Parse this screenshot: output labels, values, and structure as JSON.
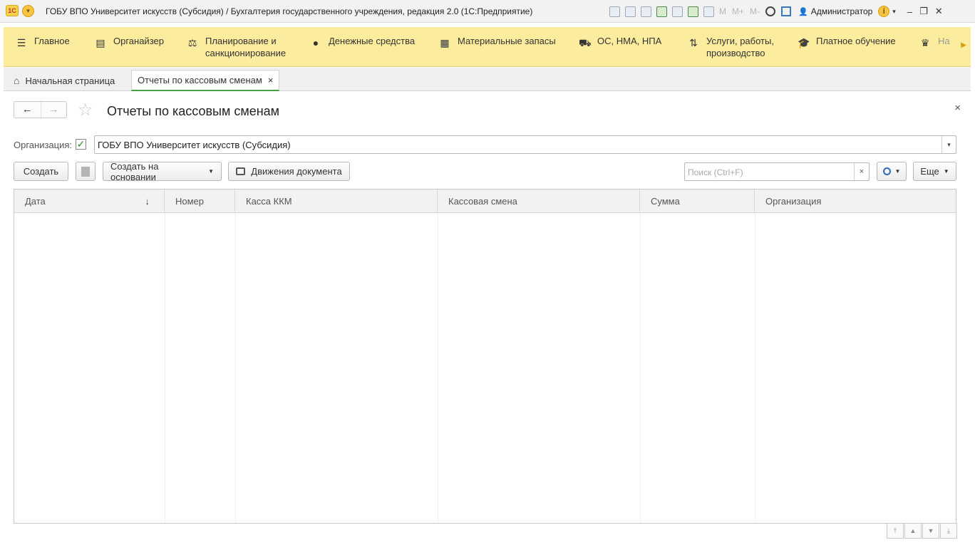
{
  "window": {
    "logo": "1C",
    "title": "ГОБУ ВПО Университет искусств (Субсидия) / Бухгалтерия государственного учреждения, редакция 2.0  (1С:Предприятие)",
    "memory_labels": [
      "M",
      "M+",
      "M-"
    ],
    "user": "Администратор",
    "info_glyph": "i"
  },
  "sections": [
    {
      "icon": "hamburger-icon",
      "label": "Главное"
    },
    {
      "icon": "organizer-icon",
      "label": "Органайзер"
    },
    {
      "icon": "planning-icon",
      "label": "Планирование и санкционирование"
    },
    {
      "icon": "ruble-coin-icon",
      "label": "Денежные средства"
    },
    {
      "icon": "warehouse-icon",
      "label": "Материальные запасы"
    },
    {
      "icon": "truck-icon",
      "label": "ОС, НМА, НПА"
    },
    {
      "icon": "tools-icon",
      "label": "Услуги, работы, производство"
    },
    {
      "icon": "graduation-cap-icon",
      "label": "Платное обучение"
    },
    {
      "icon": "emblem-icon",
      "label": "На"
    }
  ],
  "tabs": {
    "home": "Начальная страница",
    "active": "Отчеты по кассовым сменам",
    "close_glyph": "×"
  },
  "form": {
    "title": "Отчеты по кассовым сменам",
    "organization_label": "Организация:",
    "organization_checked": true,
    "organization_value": "ГОБУ ВПО Университет искусств (Субсидия)",
    "buttons": {
      "create": "Создать",
      "create_based_on": "Создать на основании",
      "document_movements": "Движения документа",
      "more": "Еще"
    },
    "search": {
      "placeholder": "Поиск (Ctrl+F)",
      "value": ""
    }
  },
  "table": {
    "columns": [
      "Дата",
      "Номер",
      "Касса ККМ",
      "Кассовая смена",
      "Сумма",
      "Организация"
    ],
    "sort_column": "Дата",
    "sort_direction": "descending",
    "rows": []
  },
  "accent_colors": {
    "sections_panel": "#fbec9e",
    "active_tab_underline": "#45a045",
    "check_mark": "#2e8b2e",
    "search_icon": "#2f6db5"
  }
}
